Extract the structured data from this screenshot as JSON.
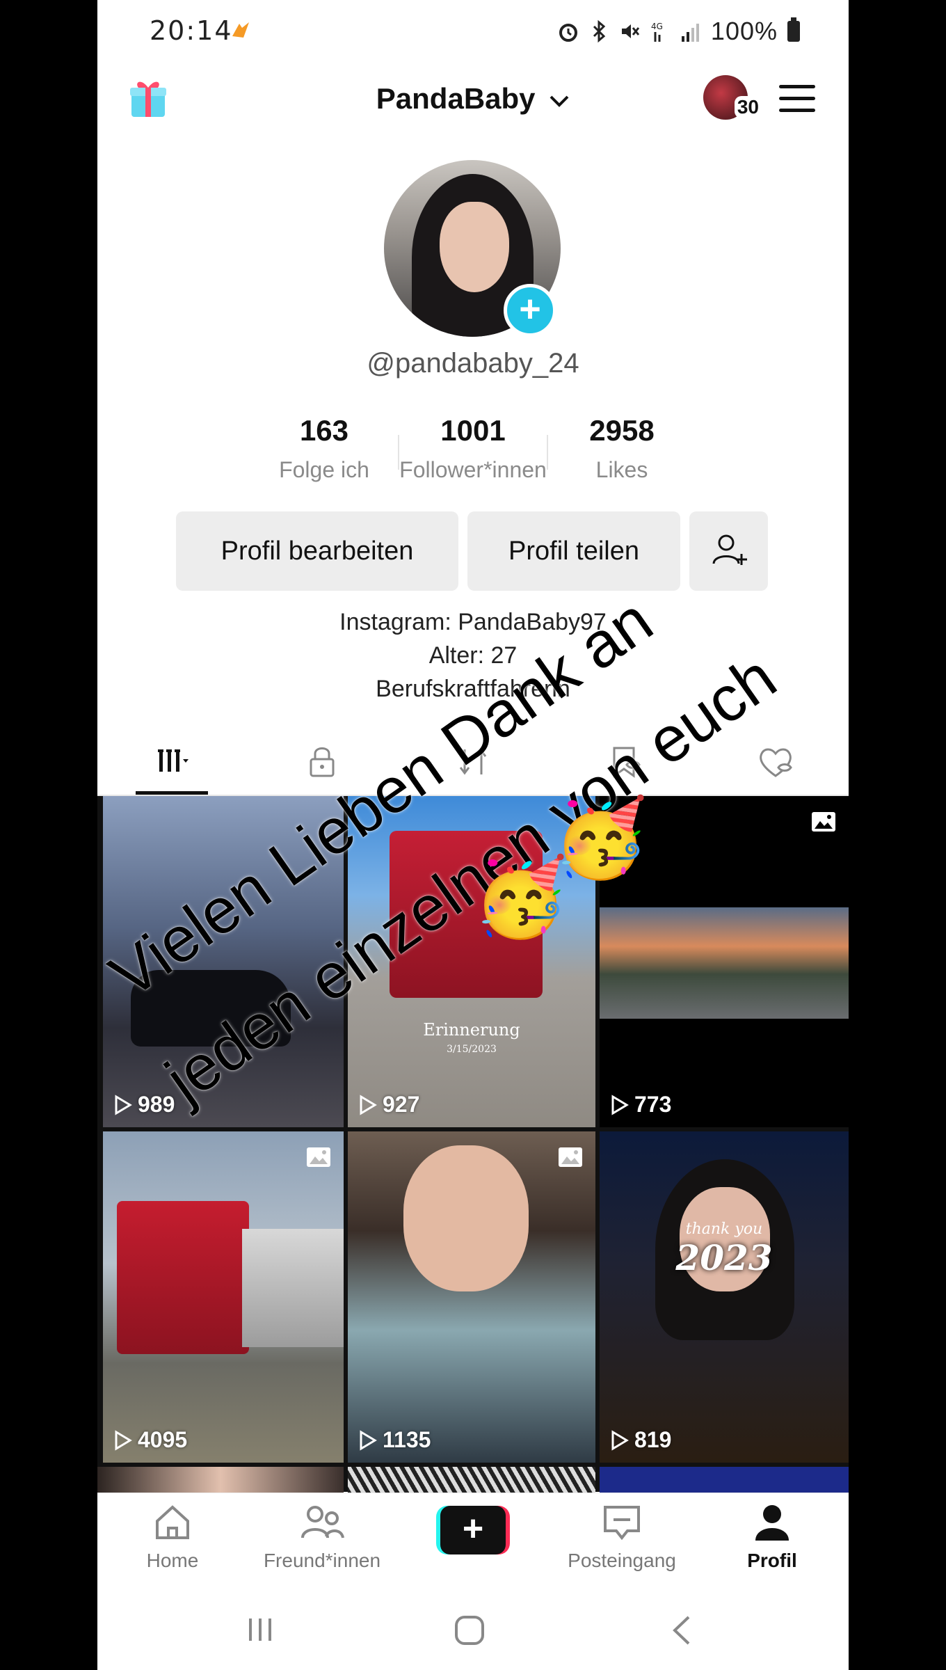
{
  "status_bar": {
    "time": "20:14",
    "battery": "100%"
  },
  "header": {
    "title": "PandaBaby",
    "notification_count": "30"
  },
  "profile": {
    "handle": "@pandababy_24",
    "stats": [
      {
        "value": "163",
        "label": "Folge ich"
      },
      {
        "value": "1001",
        "label": "Follower*innen"
      },
      {
        "value": "2958",
        "label": "Likes"
      }
    ],
    "buttons": {
      "edit": "Profil bearbeiten",
      "share": "Profil teilen"
    },
    "bio": [
      "Instagram: PandaBaby97",
      "Alter: 27",
      "Berufskraftfahrerin"
    ]
  },
  "tabs": [
    "videos",
    "private",
    "reposts",
    "favorites",
    "liked"
  ],
  "videos": [
    {
      "views": "989",
      "photo": false
    },
    {
      "views": "927",
      "photo": false,
      "caption": "Erinnerung",
      "date": "3/15/2023"
    },
    {
      "views": "773",
      "photo": true
    },
    {
      "views": "4095",
      "photo": true
    },
    {
      "views": "1135",
      "photo": true
    },
    {
      "views": "819",
      "photo": false,
      "caption_small": "thank you",
      "caption_year": "2023"
    }
  ],
  "overlay": {
    "line1": "Vielen Lieben Dank an",
    "line2": "jeden einzelnen von euch",
    "emoji": "🥳"
  },
  "bottom_nav": [
    {
      "label": "Home",
      "icon": "home-icon"
    },
    {
      "label": "Freund*innen",
      "icon": "friends-icon"
    },
    {
      "label": "Posteingang",
      "icon": "inbox-icon"
    },
    {
      "label": "Profil",
      "icon": "profile-icon"
    }
  ],
  "colors": {
    "accent_cyan": "#25f4ee",
    "accent_red": "#fe2c55",
    "add_badge": "#22c3e6"
  }
}
